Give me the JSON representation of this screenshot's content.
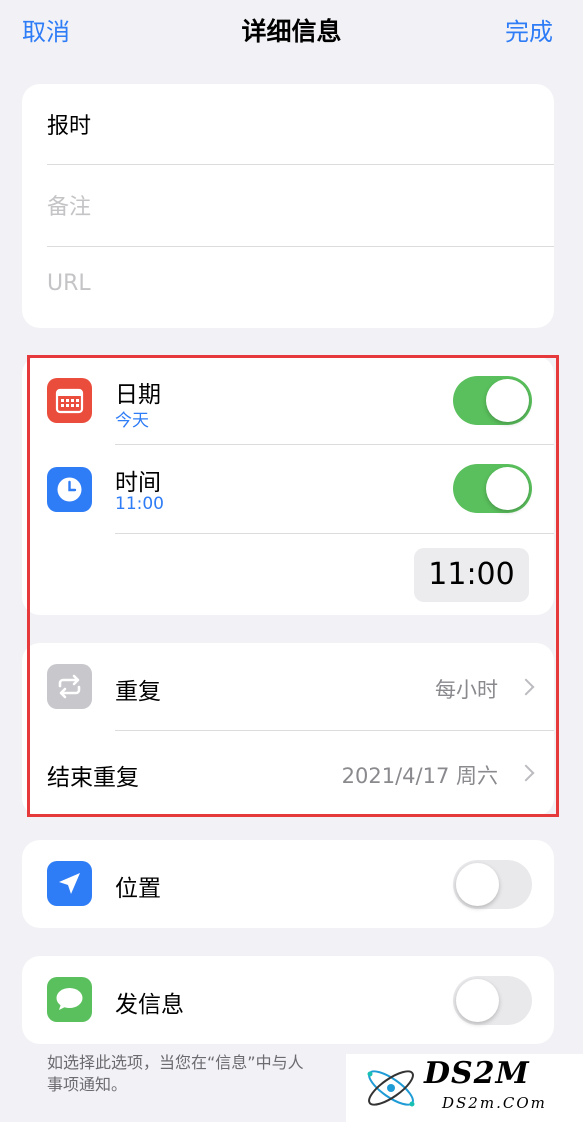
{
  "nav": {
    "cancel": "取消",
    "title": "详细信息",
    "done": "完成"
  },
  "details": {
    "title": "报时",
    "notes_placeholder": "备注",
    "url_placeholder": "URL"
  },
  "date": {
    "label": "日期",
    "value": "今天",
    "enabled": true
  },
  "time": {
    "label": "时间",
    "value": "11:00",
    "enabled": true,
    "picker": "11:00"
  },
  "repeat": {
    "label": "重复",
    "value": "每小时"
  },
  "end_repeat": {
    "label": "结束重复",
    "value": "2021/4/17 周六"
  },
  "location": {
    "label": "位置",
    "enabled": false
  },
  "messaging": {
    "label": "发信息",
    "enabled": false
  },
  "footnote": "如选择此选项，当您在“信息”中与人\n事项通知。",
  "watermark": {
    "logo": "DS2M",
    "url": "DS2m.COm"
  },
  "colors": {
    "accent": "#2e7cf6",
    "toggle_on": "#5ac05d",
    "calendar_icon": "#eb4d3d",
    "clock_icon": "#2e7cf6",
    "repeat_icon": "#c7c7cc",
    "location_icon": "#2e7cf6",
    "message_icon": "#5ac05d",
    "highlight": "#e5393c"
  }
}
